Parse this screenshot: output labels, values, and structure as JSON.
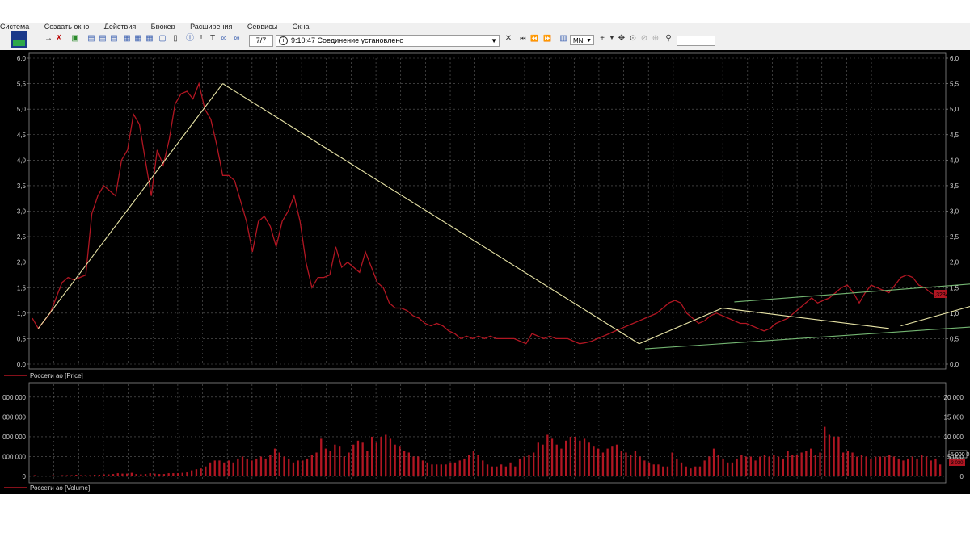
{
  "menu": [
    "Система",
    "Создать окно",
    "Действия",
    "Брокер",
    "Расширения",
    "Сервисы",
    "Окна"
  ],
  "toolbar": {
    "counter": "7/7",
    "status_text": "9:10:47  Соединение установлено",
    "interval": "MN"
  },
  "price_panel": {
    "legend": "Россети ао [Price]",
    "y_ticks": [
      "0,0",
      "0,5",
      "1,0",
      "1,5",
      "2,0",
      "2,5",
      "3,0",
      "3,5",
      "4,0",
      "4,5",
      "5,0",
      "5,5",
      "6,0"
    ],
    "last_label": "1,3234"
  },
  "volume_panel": {
    "legend": "Россети ао [Volume]",
    "left_ticks": [
      "0",
      "000 000",
      "000 000",
      "000 000",
      "000 000"
    ],
    "right_ticks": [
      "0",
      "5 000",
      "10 000",
      "15 000",
      "20 000"
    ],
    "right_highlight": "5 000 0",
    "last_label": "3 030"
  },
  "colors": {
    "background": "#000000",
    "price_line": "#b11622",
    "volume_bars": "#b11622",
    "trend_yellow": "#e8e4a6",
    "trend_green": "#74b672",
    "grid": "#5f5f5f"
  },
  "chart_data": [
    {
      "type": "line",
      "series": [
        {
          "name": "Россети ао [Price]",
          "y": [
            0.9,
            0.7,
            0.85,
            1.0,
            1.3,
            1.6,
            1.7,
            1.65,
            1.7,
            1.75,
            2.95,
            3.3,
            3.5,
            3.4,
            3.3,
            4.0,
            4.2,
            4.9,
            4.7,
            4.0,
            3.3,
            4.2,
            3.9,
            4.4,
            5.1,
            5.3,
            5.35,
            5.2,
            5.5,
            5.0,
            4.8,
            4.3,
            3.7,
            3.7,
            3.6,
            3.2,
            2.8,
            2.2,
            2.8,
            2.9,
            2.7,
            2.3,
            2.8,
            3.0,
            3.3,
            2.8,
            2.0,
            1.5,
            1.7,
            1.7,
            1.75,
            2.3,
            1.9,
            2.0,
            1.9,
            1.8,
            2.2,
            1.9,
            1.6,
            1.5,
            1.2,
            1.1,
            1.1,
            1.05,
            0.95,
            0.9,
            0.8,
            0.75,
            0.8,
            0.75,
            0.65,
            0.6,
            0.5,
            0.55,
            0.5,
            0.55,
            0.5,
            0.55,
            0.5,
            0.5,
            0.5,
            0.5,
            0.45,
            0.4,
            0.6,
            0.55,
            0.5,
            0.55,
            0.5,
            0.5,
            0.5,
            0.45,
            0.4,
            0.42,
            0.45,
            0.5,
            0.55,
            0.6,
            0.65,
            0.7,
            0.75,
            0.8,
            0.85,
            0.9,
            0.95,
            1.0,
            1.1,
            1.2,
            1.25,
            1.2,
            1.0,
            0.9,
            0.8,
            0.85,
            0.95,
            1.0,
            0.95,
            0.9,
            0.85,
            0.8,
            0.8,
            0.75,
            0.7,
            0.65,
            0.7,
            0.8,
            0.85,
            0.9,
            1.0,
            1.1,
            1.2,
            1.3,
            1.2,
            1.25,
            1.3,
            1.4,
            1.5,
            1.55,
            1.4,
            1.2,
            1.4,
            1.55,
            1.5,
            1.45,
            1.4,
            1.55,
            1.7,
            1.75,
            1.7,
            1.55,
            1.5,
            1.4,
            1.35,
            1.32
          ]
        }
      ],
      "trendlines": [
        {
          "color": "yellow",
          "from": [
            1,
            0.7
          ],
          "to": [
            32,
            5.5
          ]
        },
        {
          "color": "yellow",
          "from": [
            32,
            5.5
          ],
          "to": [
            102,
            0.4
          ]
        },
        {
          "color": "yellow",
          "from": [
            102,
            0.4
          ],
          "to": [
            116,
            1.1
          ]
        },
        {
          "color": "yellow",
          "from": [
            116,
            1.1
          ],
          "to": [
            144,
            0.7
          ]
        },
        {
          "color": "yellow",
          "from": [
            146,
            0.75
          ],
          "to": [
            178,
            1.8
          ]
        },
        {
          "color": "yellow",
          "from": [
            178,
            1.8
          ],
          "to": [
            184,
            1.25
          ]
        },
        {
          "color": "green",
          "from": [
            103,
            0.3
          ],
          "to": [
            186,
            0.95
          ]
        },
        {
          "color": "green",
          "from": [
            118,
            1.22
          ],
          "to": [
            186,
            1.82
          ]
        }
      ],
      "ylim": [
        0,
        6
      ]
    },
    {
      "type": "bar",
      "series": [
        {
          "name": "Россети ао [Volume]",
          "values": [
            300,
            200,
            200,
            200,
            300,
            200,
            300,
            300,
            300,
            400,
            300,
            300,
            300,
            400,
            400,
            500,
            500,
            600,
            800,
            700,
            700,
            900,
            600,
            500,
            600,
            800,
            700,
            600,
            600,
            800,
            800,
            800,
            900,
            1000,
            1500,
            1800,
            2000,
            2500,
            3500,
            4000,
            4000,
            3500,
            4000,
            3500,
            4500,
            5000,
            4500,
            4000,
            4500,
            5000,
            4500,
            5500,
            7000,
            6000,
            5000,
            4500,
            3500,
            4000,
            4000,
            4500,
            5500,
            6000,
            9500,
            7000,
            6500,
            8000,
            7500,
            5000,
            6000,
            8000,
            9000,
            8500,
            6500,
            10000,
            8500,
            10000,
            10500,
            9500,
            8000,
            7500,
            6500,
            6000,
            5000,
            5000,
            4000,
            3500,
            3000,
            3000,
            3000,
            3000,
            3500,
            3500,
            4000,
            4500,
            5500,
            6500,
            5500,
            4000,
            3000,
            2500,
            2500,
            3000,
            2500,
            3500,
            2500,
            4500,
            5000,
            5500,
            6000,
            8500,
            8000,
            10500,
            9500,
            8000,
            7000,
            9000,
            10000,
            10000,
            9000,
            9500,
            8500,
            7500,
            7000,
            6000,
            7000,
            7500,
            8000,
            6500,
            6000,
            5500,
            6500,
            5000,
            4000,
            3500,
            3000,
            3000,
            2500,
            2500,
            6000,
            4500,
            3500,
            2500,
            2000,
            2500,
            2500,
            4000,
            5000,
            7000,
            5500,
            4500,
            3500,
            3500,
            4500,
            5500,
            5000,
            5000,
            4000,
            5000,
            5500,
            5000,
            5500,
            5000,
            4500,
            6500,
            5500,
            5500,
            6000,
            6500,
            7000,
            5500,
            6000,
            12500,
            10500,
            10000,
            10000,
            6000,
            6500,
            6000,
            5000,
            5500,
            5000,
            4500,
            5000,
            5000,
            5000,
            5500,
            5000,
            4500,
            4000,
            4500,
            5000,
            4500,
            5500,
            5000,
            4000,
            4500,
            3000
          ]
        }
      ],
      "ylim": [
        0,
        22000
      ]
    }
  ]
}
